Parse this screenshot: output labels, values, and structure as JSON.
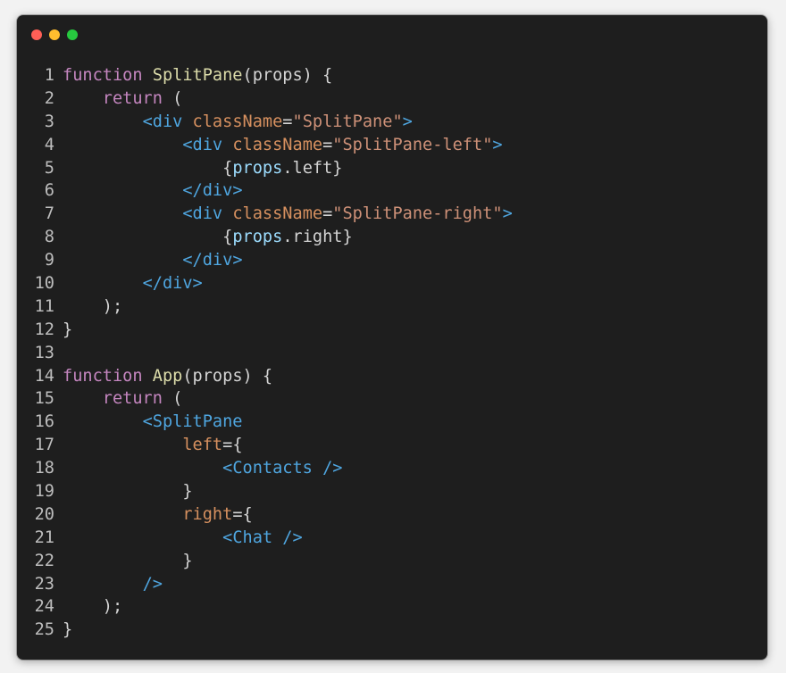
{
  "window": {
    "traffic_lights": [
      {
        "name": "close",
        "color": "#ff5f56"
      },
      {
        "name": "minimize",
        "color": "#ffbd2e"
      },
      {
        "name": "zoom",
        "color": "#27c93f"
      }
    ]
  },
  "code": {
    "lines": [
      {
        "n": "1",
        "tokens": [
          {
            "t": "function ",
            "c": "kw"
          },
          {
            "t": "SplitPane",
            "c": "fn"
          },
          {
            "t": "(props) {",
            "c": "plain"
          }
        ]
      },
      {
        "n": "2",
        "tokens": [
          {
            "t": "    ",
            "c": "plain"
          },
          {
            "t": "return",
            "c": "kw"
          },
          {
            "t": " (",
            "c": "plain"
          }
        ]
      },
      {
        "n": "3",
        "tokens": [
          {
            "t": "        ",
            "c": "plain"
          },
          {
            "t": "<div",
            "c": "tag"
          },
          {
            "t": " ",
            "c": "plain"
          },
          {
            "t": "className",
            "c": "attr"
          },
          {
            "t": "=",
            "c": "plain"
          },
          {
            "t": "\"SplitPane\"",
            "c": "str"
          },
          {
            "t": ">",
            "c": "tag"
          }
        ]
      },
      {
        "n": "4",
        "tokens": [
          {
            "t": "            ",
            "c": "plain"
          },
          {
            "t": "<div",
            "c": "tag"
          },
          {
            "t": " ",
            "c": "plain"
          },
          {
            "t": "className",
            "c": "attr"
          },
          {
            "t": "=",
            "c": "plain"
          },
          {
            "t": "\"SplitPane-left\"",
            "c": "str"
          },
          {
            "t": ">",
            "c": "tag"
          }
        ]
      },
      {
        "n": "5",
        "tokens": [
          {
            "t": "                ",
            "c": "plain"
          },
          {
            "t": "{",
            "c": "plain"
          },
          {
            "t": "props",
            "c": "var"
          },
          {
            "t": ".left}",
            "c": "plain"
          }
        ]
      },
      {
        "n": "6",
        "tokens": [
          {
            "t": "            ",
            "c": "plain"
          },
          {
            "t": "</div>",
            "c": "tag"
          }
        ]
      },
      {
        "n": "7",
        "tokens": [
          {
            "t": "            ",
            "c": "plain"
          },
          {
            "t": "<div",
            "c": "tag"
          },
          {
            "t": " ",
            "c": "plain"
          },
          {
            "t": "className",
            "c": "attr"
          },
          {
            "t": "=",
            "c": "plain"
          },
          {
            "t": "\"SplitPane-right\"",
            "c": "str"
          },
          {
            "t": ">",
            "c": "tag"
          }
        ]
      },
      {
        "n": "8",
        "tokens": [
          {
            "t": "                ",
            "c": "plain"
          },
          {
            "t": "{",
            "c": "plain"
          },
          {
            "t": "props",
            "c": "var"
          },
          {
            "t": ".right}",
            "c": "plain"
          }
        ]
      },
      {
        "n": "9",
        "tokens": [
          {
            "t": "            ",
            "c": "plain"
          },
          {
            "t": "</div>",
            "c": "tag"
          }
        ]
      },
      {
        "n": "10",
        "tokens": [
          {
            "t": "        ",
            "c": "plain"
          },
          {
            "t": "</div>",
            "c": "tag"
          }
        ]
      },
      {
        "n": "11",
        "tokens": [
          {
            "t": "    );",
            "c": "plain"
          }
        ]
      },
      {
        "n": "12",
        "tokens": [
          {
            "t": "}",
            "c": "plain"
          }
        ]
      },
      {
        "n": "13",
        "tokens": []
      },
      {
        "n": "14",
        "tokens": [
          {
            "t": "function ",
            "c": "kw"
          },
          {
            "t": "App",
            "c": "fn"
          },
          {
            "t": "(props) {",
            "c": "plain"
          }
        ]
      },
      {
        "n": "15",
        "tokens": [
          {
            "t": "    ",
            "c": "plain"
          },
          {
            "t": "return",
            "c": "kw"
          },
          {
            "t": " (",
            "c": "plain"
          }
        ]
      },
      {
        "n": "16",
        "tokens": [
          {
            "t": "        ",
            "c": "plain"
          },
          {
            "t": "<SplitPane",
            "c": "tag"
          }
        ]
      },
      {
        "n": "17",
        "tokens": [
          {
            "t": "            ",
            "c": "plain"
          },
          {
            "t": "left",
            "c": "attr"
          },
          {
            "t": "={",
            "c": "plain"
          }
        ]
      },
      {
        "n": "18",
        "tokens": [
          {
            "t": "                ",
            "c": "plain"
          },
          {
            "t": "<Contacts />",
            "c": "tag"
          }
        ]
      },
      {
        "n": "19",
        "tokens": [
          {
            "t": "            }",
            "c": "plain"
          }
        ]
      },
      {
        "n": "20",
        "tokens": [
          {
            "t": "            ",
            "c": "plain"
          },
          {
            "t": "right",
            "c": "attr"
          },
          {
            "t": "={",
            "c": "plain"
          }
        ]
      },
      {
        "n": "21",
        "tokens": [
          {
            "t": "                ",
            "c": "plain"
          },
          {
            "t": "<Chat />",
            "c": "tag"
          }
        ]
      },
      {
        "n": "22",
        "tokens": [
          {
            "t": "            }",
            "c": "plain"
          }
        ]
      },
      {
        "n": "23",
        "tokens": [
          {
            "t": "        ",
            "c": "plain"
          },
          {
            "t": "/>",
            "c": "tag"
          }
        ]
      },
      {
        "n": "24",
        "tokens": [
          {
            "t": "    );",
            "c": "plain"
          }
        ]
      },
      {
        "n": "25",
        "tokens": [
          {
            "t": "}",
            "c": "plain"
          }
        ]
      }
    ]
  }
}
